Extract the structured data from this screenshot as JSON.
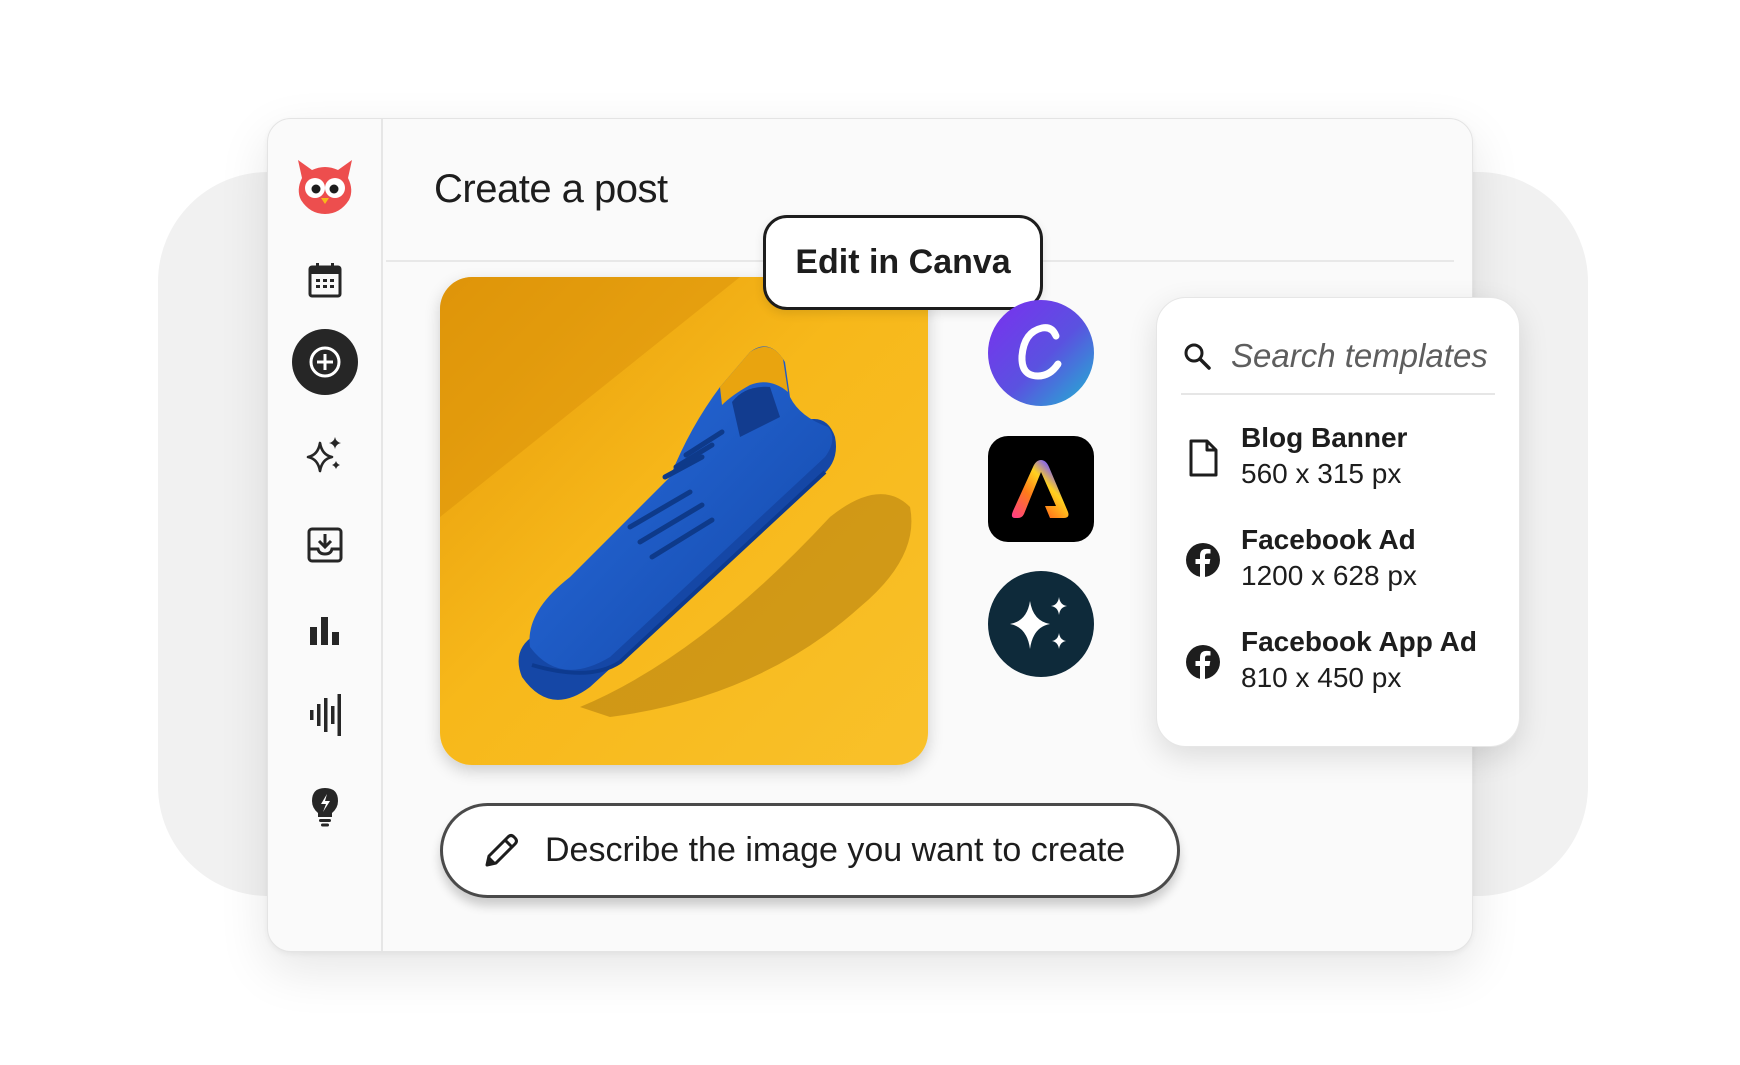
{
  "page": {
    "title": "Create a post"
  },
  "sidebar": {
    "items": [
      {
        "name": "planner",
        "icon": "calendar-icon"
      },
      {
        "name": "create",
        "icon": "plus-circle-icon",
        "active": true
      },
      {
        "name": "ai-assistant",
        "icon": "sparkles-icon"
      },
      {
        "name": "inbox",
        "icon": "inbox-icon"
      },
      {
        "name": "analytics",
        "icon": "bar-chart-icon"
      },
      {
        "name": "listening",
        "icon": "sound-bars-icon"
      },
      {
        "name": "ideas",
        "icon": "lightbulb-icon"
      }
    ],
    "logo": "owl-logo-icon"
  },
  "editor": {
    "canva_button_label": "Edit in Canva",
    "image_subject": "blue-sneaker-on-yellow-photo",
    "apps": [
      "canva-icon",
      "adobe-express-icon",
      "ai-sparkle-icon"
    ],
    "prompt_text": "Describe the image you want to create"
  },
  "templates": {
    "search_placeholder": "Search templates",
    "items": [
      {
        "name": "Blog Banner",
        "size": "560 x 315 px",
        "icon": "document-icon"
      },
      {
        "name": "Facebook Ad",
        "size": "1200 x 628 px",
        "icon": "facebook-icon"
      },
      {
        "name": "Facebook App Ad",
        "size": "810 x 450 px",
        "icon": "facebook-icon"
      }
    ]
  },
  "colors": {
    "owl_red": "#ed4e4e",
    "dark": "#1d1d1d",
    "yellow": "#f7b81a",
    "shoe_blue": "#1f5fc8",
    "canva_purple": "#7b2ff0",
    "canva_teal": "#1fb6d1",
    "ai_navy": "#0e2a3a"
  }
}
